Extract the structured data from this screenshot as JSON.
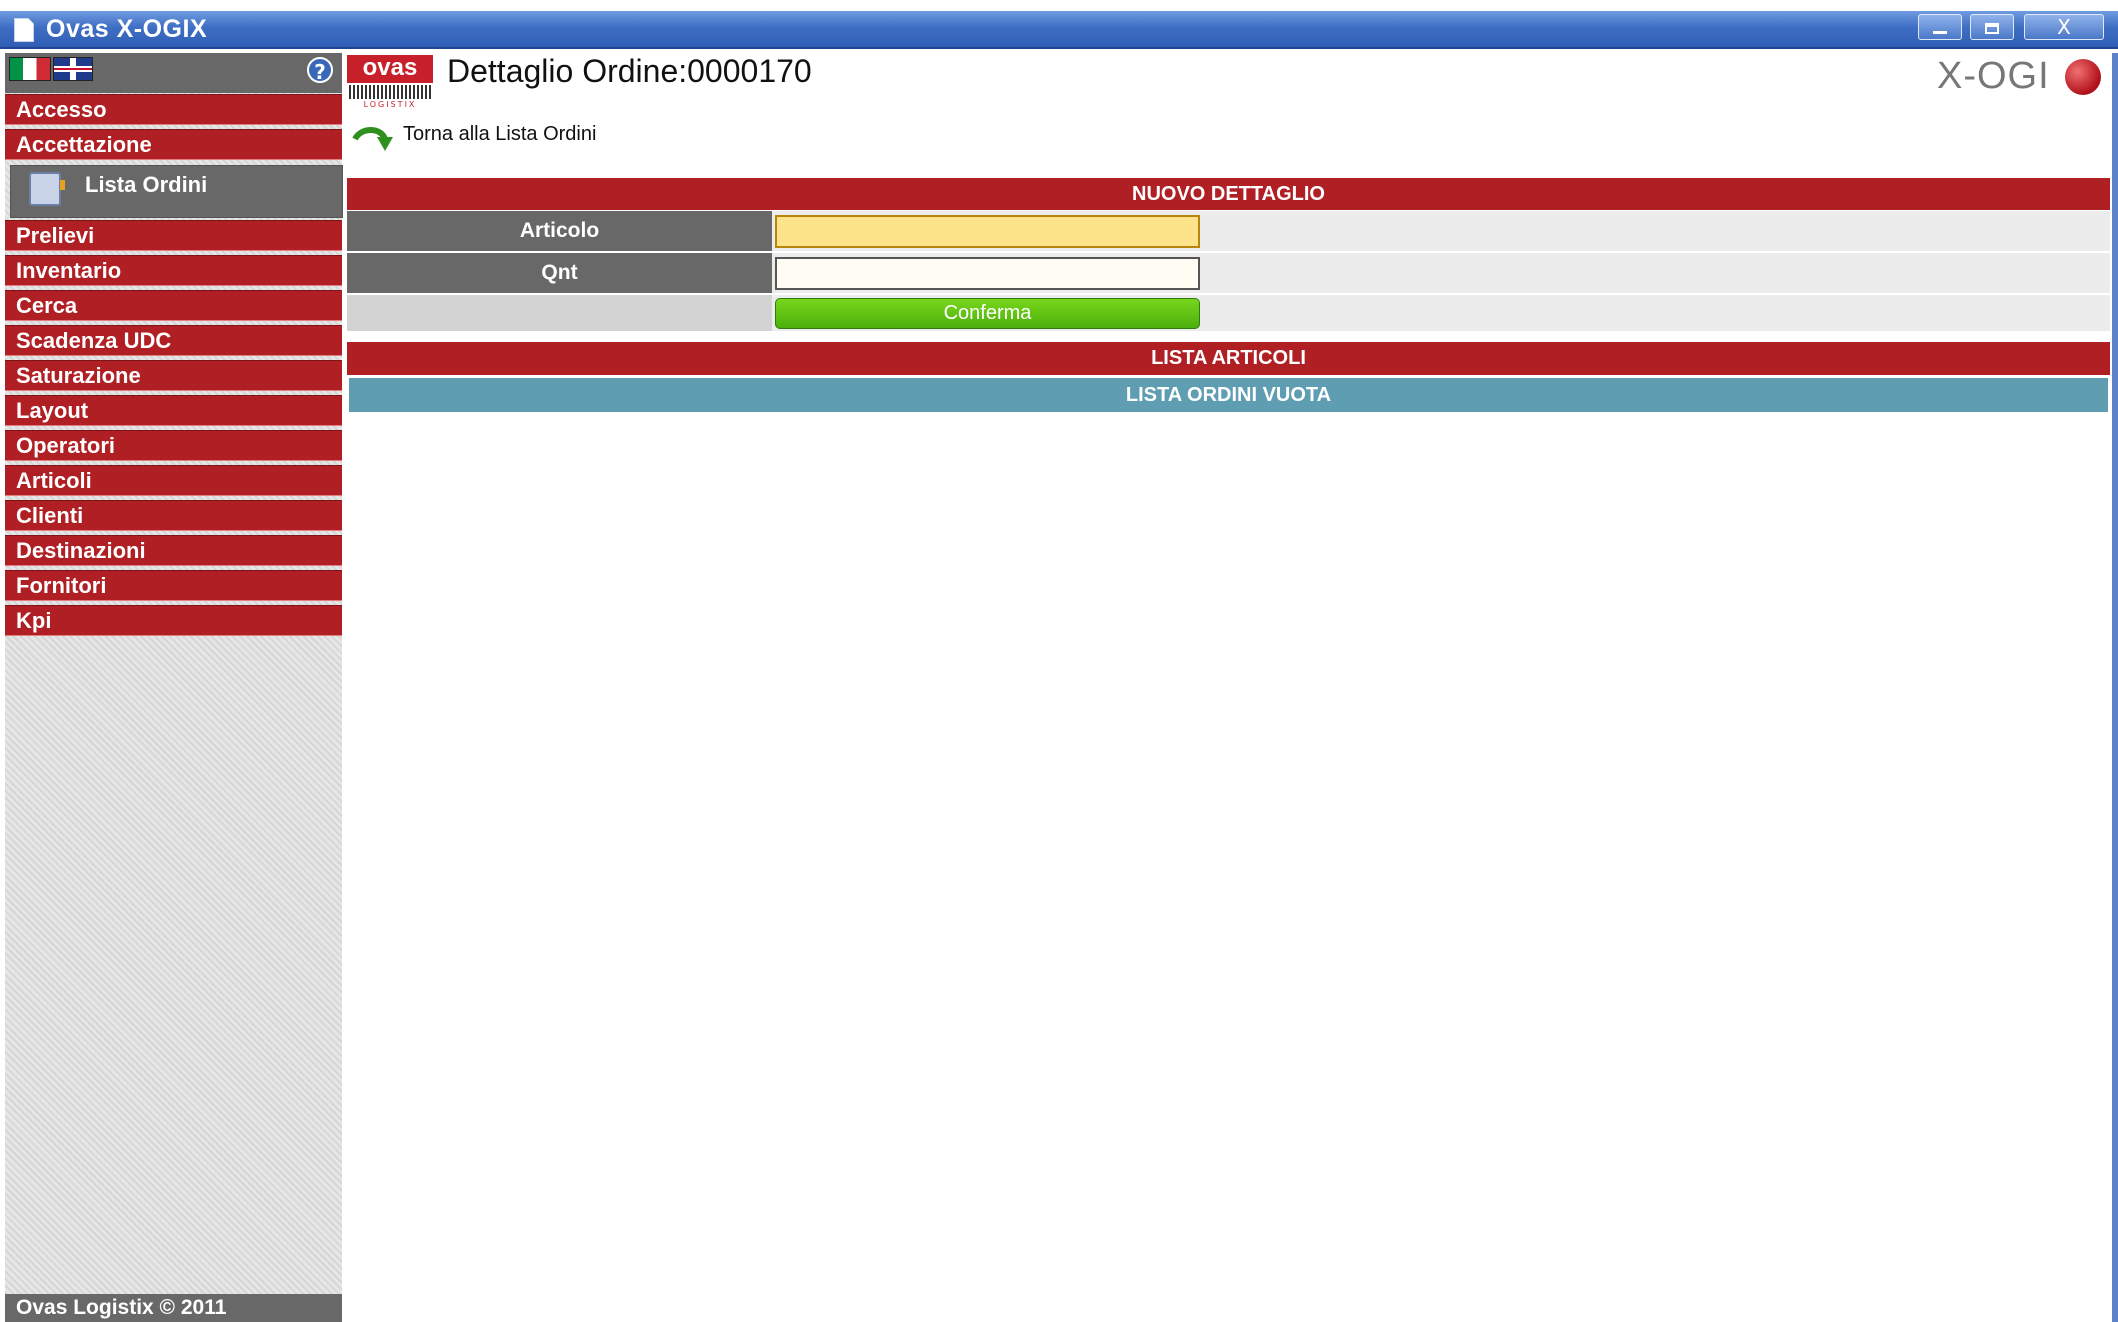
{
  "window": {
    "title": "Ovas X-OGIX",
    "minimize": "",
    "maximize": "",
    "close": "X"
  },
  "sidebar": {
    "help": "?",
    "menu": [
      {
        "label": "Accesso"
      },
      {
        "label": "Accettazione"
      },
      {
        "label": "Prelievi"
      },
      {
        "label": "Inventario"
      },
      {
        "label": "Cerca"
      },
      {
        "label": "Scadenza UDC"
      },
      {
        "label": "Saturazione"
      },
      {
        "label": "Layout"
      },
      {
        "label": "Operatori"
      },
      {
        "label": "Articoli"
      },
      {
        "label": "Clienti"
      },
      {
        "label": "Destinazioni"
      },
      {
        "label": "Fornitori"
      },
      {
        "label": "Kpi"
      }
    ],
    "submenu": {
      "label": "Lista Ordini",
      "icon": "order-list-icon"
    },
    "footer": "Ovas Logistix © 2011"
  },
  "header": {
    "logo_text": "ovas",
    "logo_subtext": "LOGISTIX",
    "title": "Dettaglio Ordine:0000170",
    "brand_logo": "X-OGI",
    "back_link": "Torna alla Lista Ordini"
  },
  "form": {
    "section_title": "NUOVO DETTAGLIO",
    "articolo_label": "Articolo",
    "articolo_value": "",
    "qnt_label": "Qnt",
    "qnt_value": "",
    "confirm_label": "Conferma"
  },
  "list": {
    "section_title": "LISTA ARTICOLI",
    "empty_message": "LISTA ORDINI VUOTA"
  },
  "colors": {
    "titlebar": "#3f6fc4",
    "menu_red": "#b01f24",
    "dark_gray": "#686868",
    "confirm_green": "#5cc214",
    "empty_blue": "#5f9db3",
    "articolo_highlight": "#fde38a"
  }
}
